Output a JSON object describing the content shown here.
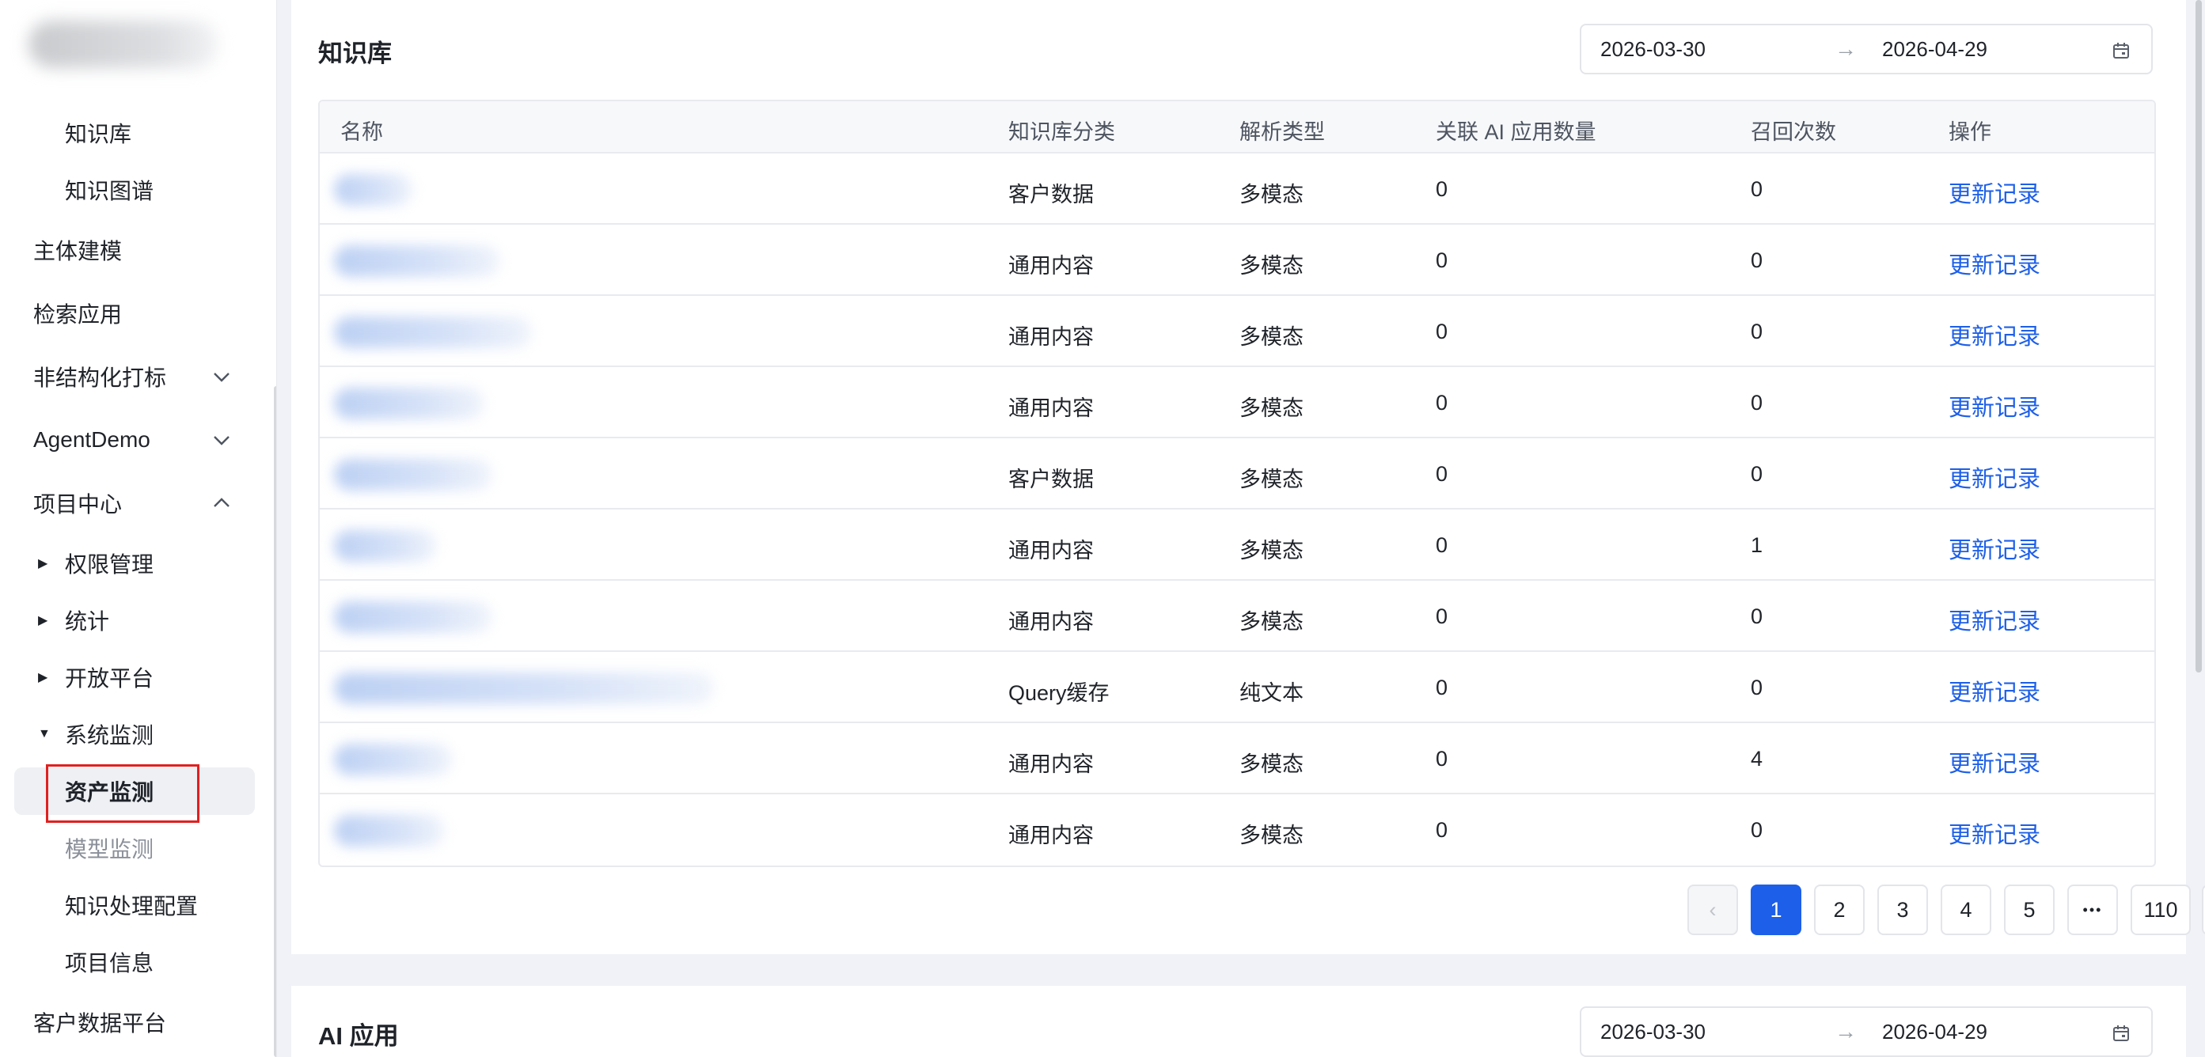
{
  "sidebar": {
    "items": [
      {
        "label": "知识库",
        "level": 2
      },
      {
        "label": "知识图谱",
        "level": 2
      },
      {
        "label": "主体建模",
        "level": 1
      },
      {
        "label": "检索应用",
        "level": 1
      },
      {
        "label": "非结构化打标",
        "level": 1,
        "chevron": "down"
      },
      {
        "label": "AgentDemo",
        "level": 1,
        "chevron": "down"
      },
      {
        "label": "项目中心",
        "level": 1,
        "chevron": "up"
      },
      {
        "label": "权限管理",
        "level": 2,
        "triangle": "right"
      },
      {
        "label": "统计",
        "level": 2,
        "triangle": "right"
      },
      {
        "label": "开放平台",
        "level": 2,
        "triangle": "right"
      },
      {
        "label": "系统监测",
        "level": 2,
        "triangle": "down"
      },
      {
        "label": "资产监测",
        "level": 2,
        "selected": true
      },
      {
        "label": "模型监测",
        "level": 2
      },
      {
        "label": "知识处理配置",
        "level": 2
      },
      {
        "label": "项目信息",
        "level": 2
      },
      {
        "label": "客户数据平台",
        "level": 1
      }
    ]
  },
  "knowledge_card": {
    "title": "知识库",
    "date_start": "2026-03-30",
    "date_end": "2026-04-29",
    "date_arrow": "→",
    "columns": [
      "名称",
      "知识库分类",
      "解析类型",
      "关联 AI 应用数量",
      "召回次数",
      "操作"
    ],
    "rows": [
      {
        "category": "客户数据",
        "parse_type": "多模态",
        "ai_apps": "0",
        "recalls": "0",
        "action": "更新记录"
      },
      {
        "category": "通用内容",
        "parse_type": "多模态",
        "ai_apps": "0",
        "recalls": "0",
        "action": "更新记录"
      },
      {
        "category": "通用内容",
        "parse_type": "多模态",
        "ai_apps": "0",
        "recalls": "0",
        "action": "更新记录"
      },
      {
        "category": "通用内容",
        "parse_type": "多模态",
        "ai_apps": "0",
        "recalls": "0",
        "action": "更新记录"
      },
      {
        "category": "客户数据",
        "parse_type": "多模态",
        "ai_apps": "0",
        "recalls": "0",
        "action": "更新记录"
      },
      {
        "category": "通用内容",
        "parse_type": "多模态",
        "ai_apps": "0",
        "recalls": "1",
        "action": "更新记录"
      },
      {
        "category": "通用内容",
        "parse_type": "多模态",
        "ai_apps": "0",
        "recalls": "0",
        "action": "更新记录"
      },
      {
        "category": "Query缓存",
        "parse_type": "纯文本",
        "ai_apps": "0",
        "recalls": "0",
        "action": "更新记录"
      },
      {
        "category": "通用内容",
        "parse_type": "多模态",
        "ai_apps": "0",
        "recalls": "4",
        "action": "更新记录"
      },
      {
        "category": "通用内容",
        "parse_type": "多模态",
        "ai_apps": "0",
        "recalls": "0",
        "action": "更新记录"
      }
    ],
    "pagination": {
      "prev": "‹",
      "pages": [
        "1",
        "2",
        "3",
        "4",
        "5"
      ],
      "ellipsis": "•••",
      "last": "110",
      "next": "›",
      "current": "1"
    }
  },
  "ai_card": {
    "title": "AI 应用",
    "date_start": "2026-03-30",
    "date_end": "2026-04-29",
    "date_arrow": "→"
  },
  "colors": {
    "accent": "#1d5fe8",
    "highlight": "#e02020",
    "background": "#f0f2f7"
  }
}
